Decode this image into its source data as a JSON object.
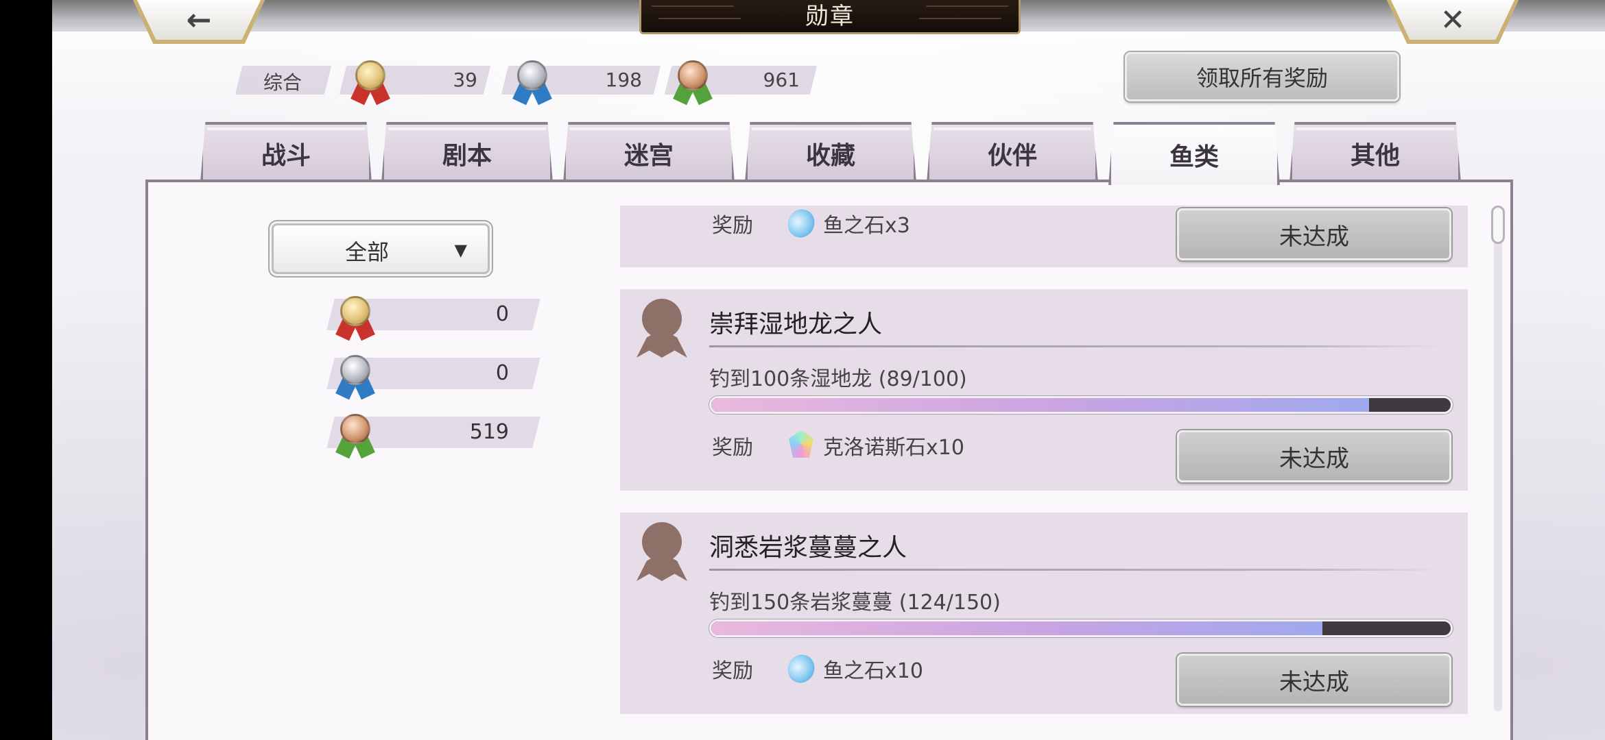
{
  "header": {
    "title": "勋章",
    "back_glyph": "←",
    "close_glyph": "✕"
  },
  "summary": {
    "label": "综合",
    "gold_count": "39",
    "silver_count": "198",
    "bronze_count": "961",
    "claim_all_label": "领取所有奖励"
  },
  "tabs": [
    {
      "label": "战斗",
      "active": false
    },
    {
      "label": "剧本",
      "active": false
    },
    {
      "label": "迷宫",
      "active": false
    },
    {
      "label": "收藏",
      "active": false
    },
    {
      "label": "伙伴",
      "active": false
    },
    {
      "label": "鱼类",
      "active": true
    },
    {
      "label": "其他",
      "active": false
    }
  ],
  "filter": {
    "selected": "全部",
    "caret": "▼"
  },
  "category_counts": {
    "gold": "0",
    "silver": "0",
    "bronze": "519"
  },
  "achievements": [
    {
      "reward_label": "奖励",
      "reward_icon": "fish-stone-icon",
      "reward_text": "鱼之石x3",
      "status": "未达成"
    },
    {
      "title": "崇拜湿地龙之人",
      "description": "钓到100条湿地龙 (89/100)",
      "progress": 0.89,
      "reward_label": "奖励",
      "reward_icon": "chronos-stone-icon",
      "reward_text": "克洛诺斯石x10",
      "status": "未达成"
    },
    {
      "title": "洞悉岩浆蔓蔓之人",
      "description": "钓到150条岩浆蔓蔓 (124/150)",
      "progress": 0.8267,
      "reward_label": "奖励",
      "reward_icon": "fish-stone-icon",
      "reward_text": "鱼之石x10",
      "status": "未达成"
    }
  ],
  "colors": {
    "panel_border": "#8a8090",
    "card_bg": "#e7dde8",
    "progress_track": "#3e3a3f"
  }
}
